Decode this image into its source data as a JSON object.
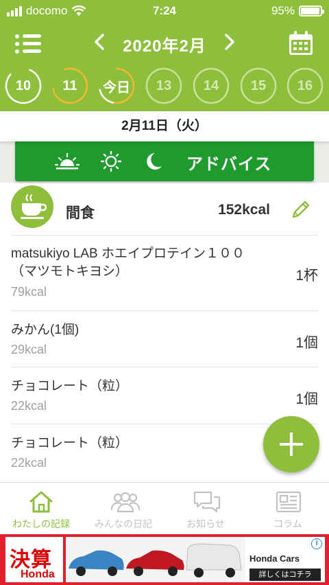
{
  "status_bar": {
    "carrier": "docomo",
    "time": "7:24",
    "battery_percent": "95%",
    "battery_level": 0.95
  },
  "header": {
    "month_title": "2020年2月",
    "prev_arrow": "<",
    "next_arrow": ">",
    "days": [
      {
        "label": "10",
        "state": "past"
      },
      {
        "label": "11",
        "state": "selected"
      },
      {
        "label": "今日",
        "state": "today"
      },
      {
        "label": "13",
        "state": "future"
      },
      {
        "label": "14",
        "state": "future"
      },
      {
        "label": "15",
        "state": "future"
      },
      {
        "label": "16",
        "state": "future"
      }
    ]
  },
  "date_bar": {
    "label": "2月11日（火）"
  },
  "advice": {
    "icons": [
      "sunrise-icon",
      "sun-icon",
      "moon-icon"
    ],
    "label": "アドバイス"
  },
  "meal": {
    "name": "間食",
    "kcal": "152kcal",
    "items": [
      {
        "name_line1": "matsukiyo LAB ホエイプロテイン１００",
        "name_line2": "（マツモトキヨシ）",
        "kcal": "79kcal",
        "qty": "1杯"
      },
      {
        "name_line1": "みかん(1個)",
        "name_line2": "",
        "kcal": "29kcal",
        "qty": "1個"
      },
      {
        "name_line1": "チョコレート（粒）",
        "name_line2": "",
        "kcal": "22kcal",
        "qty": "1個"
      },
      {
        "name_line1": "チョコレート（粒）",
        "name_line2": "",
        "kcal": "22kcal",
        "qty": ""
      }
    ]
  },
  "tabs": [
    {
      "label": "わたしの記録",
      "icon": "home-icon",
      "active": true
    },
    {
      "label": "みんなの日記",
      "icon": "people-icon",
      "active": false
    },
    {
      "label": "お知らせ",
      "icon": "chat-icon",
      "active": false
    },
    {
      "label": "コラム",
      "icon": "newspaper-icon",
      "active": false
    }
  ],
  "ad": {
    "headline": "決算",
    "brand_small": "Honda",
    "brand": "Honda Cars",
    "cta": "詳しくはコチラ",
    "info": "i"
  },
  "colors": {
    "header_green": "#8dbf3c",
    "advice_green": "#1e9b2c",
    "today_ring": "#f2b92e"
  }
}
